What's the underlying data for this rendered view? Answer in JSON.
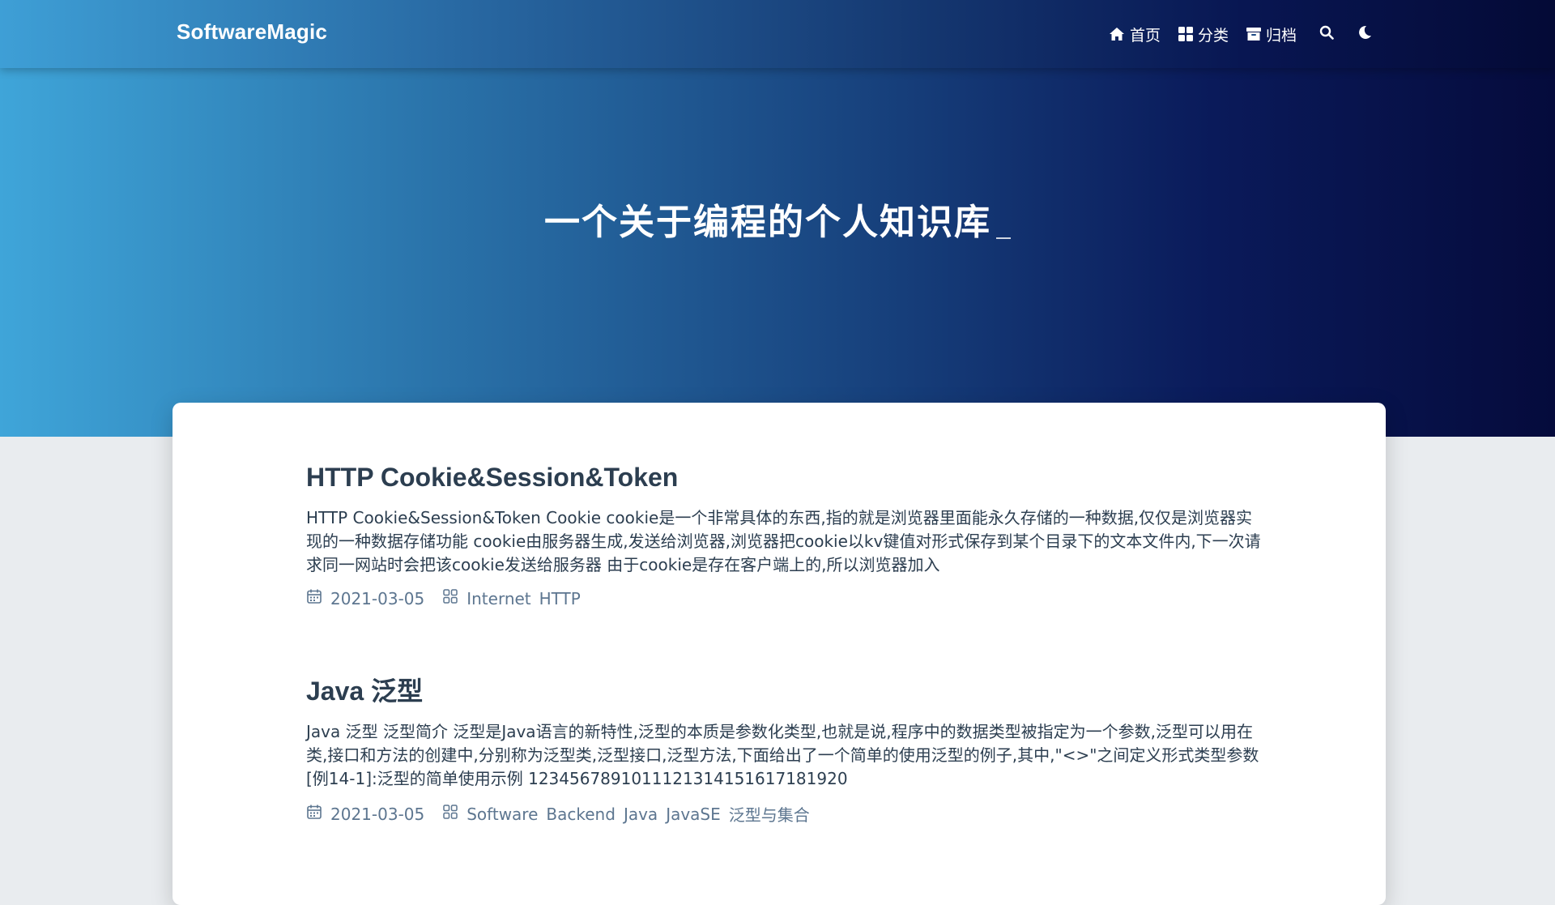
{
  "site": {
    "brand": "SoftwareMagic",
    "hero_title": "一个关于编程的个人知识库"
  },
  "nav": {
    "home": "首页",
    "categories": "分类",
    "archive": "归档",
    "icons": [
      "home-icon",
      "grid-icon",
      "archive-icon",
      "search-icon",
      "moon-icon"
    ]
  },
  "posts": [
    {
      "title": "HTTP Cookie&Session&Token",
      "excerpt": "HTTP Cookie&Session&Token Cookie cookie是一个非常具体的东西,指的就是浏览器里面能永久存储的一种数据,仅仅是浏览器实现的一种数据存储功能 cookie由服务器生成,发送给浏览器,浏览器把cookie以kv键值对形式保存到某个目录下的文本文件内,下一次请求同一网站时会把该cookie发送给服务器 由于cookie是存在客户端上的,所以浏览器加入",
      "date": "2021-03-05",
      "tags": [
        "Internet",
        "HTTP"
      ]
    },
    {
      "title": "Java 泛型",
      "excerpt": "Java 泛型 泛型简介 泛型是Java语言的新特性,泛型的本质是参数化类型,也就是说,程序中的数据类型被指定为一个参数,泛型可以用在类,接口和方法的创建中,分别称为泛型类,泛型接口,泛型方法,下面给出了一个简单的使用泛型的例子,其中,\"<>\"之间定义形式类型参数 [例14-1]:泛型的简单使用示例 1234567891011121314151617181920",
      "date": "2021-03-05",
      "tags": [
        "Software",
        "Backend",
        "Java",
        "JavaSE",
        "泛型与集合"
      ]
    }
  ],
  "colors": {
    "text": "#2c3e50",
    "meta": "#5d7690",
    "background": "#e9ecef"
  }
}
